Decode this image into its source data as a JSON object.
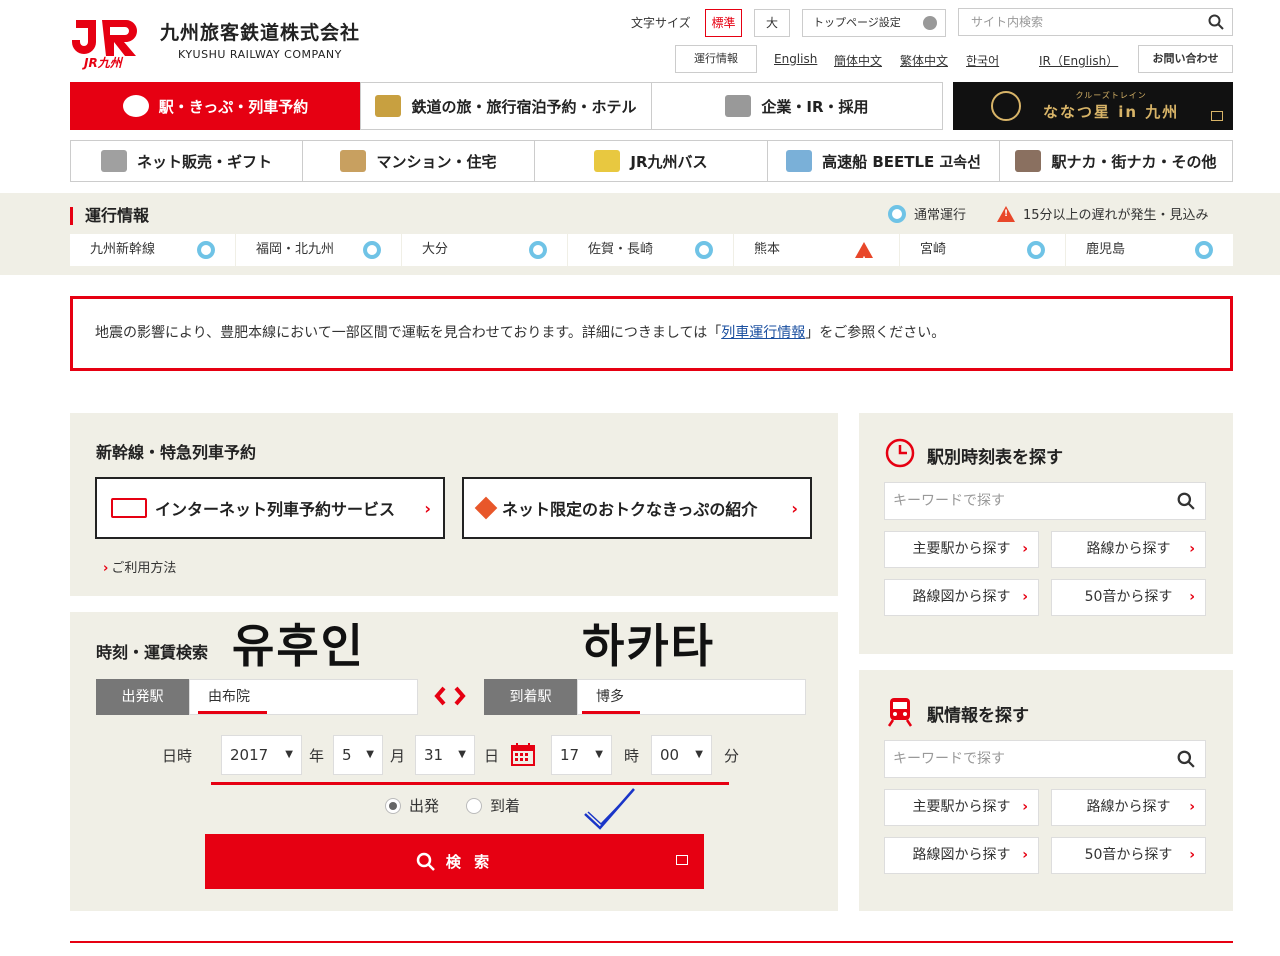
{
  "header": {
    "logo_mark": "JR",
    "logo_sub": "JR九州",
    "company_name": "九州旅客鉄道株式会社",
    "company_en": "KYUSHU RAILWAY COMPANY",
    "font_size_label": "文字サイズ",
    "font_std": "標準",
    "font_large": "大",
    "toppage_settings": "トップページ設定",
    "site_search_placeholder": "サイト内検索",
    "unkou_button": "運行情報",
    "links": [
      "English",
      "簡体中文",
      "繁体中文",
      "한국어",
      "IR（English）"
    ],
    "contact": "お問い合わせ"
  },
  "nav_primary": [
    {
      "label": "駅・きっぷ・列車予約",
      "icon": "train-icon",
      "active": true
    },
    {
      "label": "鉄道の旅・旅行宿泊予約・ホテル",
      "icon": "suitcase-icon",
      "active": false
    },
    {
      "label": "企業・IR・採用",
      "icon": "building-icon",
      "active": false
    }
  ],
  "seven_stars": {
    "small": "クルーズトレイン",
    "big": "ななつ星 in 九州"
  },
  "nav_secondary": [
    {
      "label": "ネット販売・ギフト",
      "icon": "gift-icon"
    },
    {
      "label": "マンション・住宅",
      "icon": "house-icon"
    },
    {
      "label": "JR九州バス",
      "icon": "bus-icon"
    },
    {
      "label": "高速船 BEETLE 고속선",
      "icon": "ship-icon"
    },
    {
      "label": "駅ナカ・街ナカ・その他",
      "icon": "shop-icon"
    }
  ],
  "unkou": {
    "title": "運行情報",
    "legend_normal": "通常運行",
    "legend_delay": "15分以上の遅れが発生・見込み",
    "areas": [
      {
        "name": "九州新幹線",
        "status": "normal"
      },
      {
        "name": "福岡・北九州",
        "status": "normal"
      },
      {
        "name": "大分",
        "status": "normal"
      },
      {
        "name": "佐賀・長崎",
        "status": "normal"
      },
      {
        "name": "熊本",
        "status": "delay"
      },
      {
        "name": "宮崎",
        "status": "normal"
      },
      {
        "name": "鹿児島",
        "status": "normal"
      }
    ]
  },
  "notice": {
    "before": "地震の影響により、豊肥本線において一部区間で運転を見合わせております。詳細につきましては「",
    "link": "列車運行情報",
    "after": "」をご参照ください。"
  },
  "reserve": {
    "title": "新幹線・特急列車予約",
    "btn_internet": "インターネット列車予約サービス",
    "btn_otoku": "ネット限定のおトクなきっぷの紹介",
    "usage": "ご利用方法"
  },
  "search": {
    "title": "時刻・運賃検索",
    "korean_from": "유후인",
    "korean_to": "하카타",
    "from_label": "出発駅",
    "from_value": "由布院",
    "to_label": "到着駅",
    "to_value": "博多",
    "datetime_label": "日時",
    "year": "2017",
    "year_unit": "年",
    "month": "5",
    "month_unit": "月",
    "day": "31",
    "day_unit": "日",
    "hour": "17",
    "hour_unit": "時",
    "minute": "00",
    "minute_unit": "分",
    "radio_depart": "出発",
    "radio_arrive": "到着",
    "submit": "検 索"
  },
  "timetable": {
    "title": "駅別時刻表を探す",
    "placeholder": "キーワードで探す",
    "buttons": [
      "主要駅から探す",
      "路線から探す",
      "路線図から探す",
      "50音から探す"
    ]
  },
  "station_info": {
    "title": "駅情報を探す",
    "placeholder": "キーワードで探す",
    "buttons": [
      "主要駅から探す",
      "路線から探す",
      "路線図から探す",
      "50音から探す"
    ]
  },
  "colors": {
    "brand_red": "#e60012",
    "panel_bg": "#f0efe6",
    "status_normal": "#6fc3e6",
    "status_delay": "#e8472a"
  }
}
